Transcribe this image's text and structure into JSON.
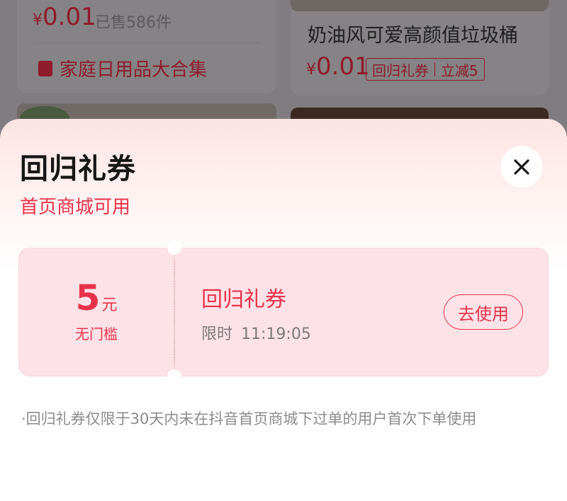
{
  "background": {
    "left_card": {
      "price_currency": "¥",
      "price_value": "0.01",
      "sold_text": "已售586件",
      "category_label": "家庭日用品大合集"
    },
    "right_card": {
      "product_title": "奶油风可爱高颜值垃圾桶",
      "price_currency": "¥",
      "price_value": "0.01",
      "tag_coupon": "回归礼券",
      "tag_discount": "立减5"
    }
  },
  "sheet": {
    "title": "回归礼券",
    "subtitle": "首页商城可用",
    "coupon": {
      "amount": "5",
      "unit": "元",
      "condition": "无门槛",
      "name": "回归礼券",
      "time_label": "限时",
      "time_value": "11:19:05",
      "use_button": "去使用"
    },
    "note": "·回归礼券仅限于30天内未在抖音首页商城下过单的用户首次下单使用"
  },
  "colors": {
    "accent": "#e8324a",
    "coupon_bg": "#fde3e8"
  },
  "icons": {
    "close": "close-icon",
    "category": "gift-bag-icon"
  }
}
